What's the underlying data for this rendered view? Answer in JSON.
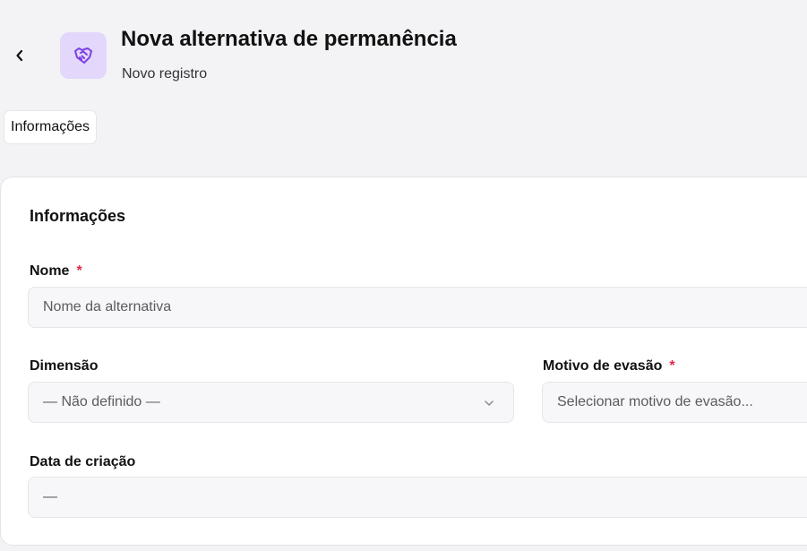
{
  "header": {
    "title": "Nova alternativa de permanência",
    "subtitle": "Novo registro",
    "icon": "handshake-icon",
    "icon_color": "#7b3fe4",
    "icon_bg": "#e3d7fb"
  },
  "tabs": [
    {
      "label": "Informações",
      "active": true
    }
  ],
  "form": {
    "section_title": "Informações",
    "required_marker": "*",
    "fields": {
      "nome": {
        "label": "Nome",
        "placeholder": "Nome da alternativa",
        "required": true
      },
      "dimensao": {
        "label": "Dimensão",
        "value": "— Não definido —",
        "required": false
      },
      "motivo": {
        "label": "Motivo de evasão",
        "placeholder": "Selecionar motivo de evasão...",
        "required": true
      },
      "data_criacao": {
        "label": "Data de criação",
        "value": "—",
        "required": false
      }
    }
  },
  "colors": {
    "background": "#f3f3f6",
    "card": "#ffffff",
    "required": "#e0294a",
    "field_bg": "#f7f7f9"
  }
}
